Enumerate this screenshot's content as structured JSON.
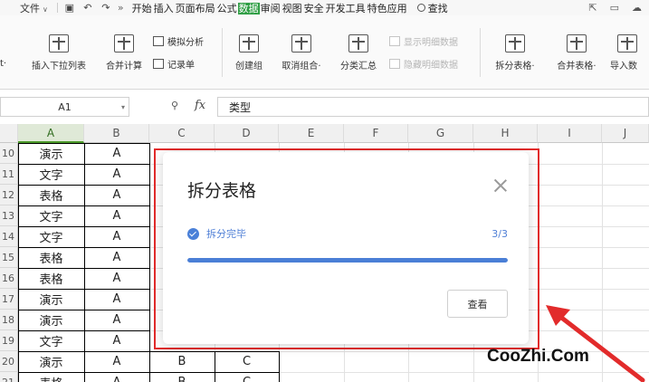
{
  "menu": {
    "file_label": "文件",
    "tabs": [
      "开始",
      "插入",
      "页面布局",
      "公式",
      "数据",
      "审阅",
      "视图",
      "安全",
      "开发工具",
      "特色应用"
    ],
    "active_tab_index": 4,
    "search_label": "查找"
  },
  "ribbon": {
    "buttons": [
      {
        "id": "insert-dropdown",
        "label": "插入下拉列表"
      },
      {
        "id": "merge-calc",
        "label": "合并计算"
      },
      {
        "id": "create-group",
        "label": "创建组"
      },
      {
        "id": "ungroup",
        "label": "取消组合·"
      },
      {
        "id": "subtotal",
        "label": "分类汇总"
      },
      {
        "id": "split-table",
        "label": "拆分表格·"
      },
      {
        "id": "merge-table",
        "label": "合并表格·"
      },
      {
        "id": "import-data",
        "label": "导入数"
      }
    ],
    "small_buttons": [
      {
        "id": "what-if",
        "label": "模拟分析"
      },
      {
        "id": "record-form",
        "label": "记录单"
      },
      {
        "id": "show-detail",
        "label": "显示明细数据"
      },
      {
        "id": "hide-detail",
        "label": "隐藏明细数据"
      }
    ],
    "left_edge_label": "t·"
  },
  "formula_bar": {
    "name_box": "A1",
    "fx_label": "fx",
    "content": "类型"
  },
  "grid": {
    "columns": [
      "A",
      "B",
      "C",
      "D",
      "E",
      "F",
      "G",
      "H",
      "I",
      "J"
    ],
    "selected_column": "A",
    "row_numbers": [
      "10",
      "11",
      "12",
      "13",
      "14",
      "15",
      "16",
      "17",
      "18",
      "19",
      "20",
      "21"
    ],
    "rows": [
      [
        "演示",
        "A",
        "",
        ""
      ],
      [
        "文字",
        "A",
        "",
        ""
      ],
      [
        "表格",
        "A",
        "",
        ""
      ],
      [
        "文字",
        "A",
        "",
        ""
      ],
      [
        "文字",
        "A",
        "",
        ""
      ],
      [
        "表格",
        "A",
        "",
        ""
      ],
      [
        "表格",
        "A",
        "",
        ""
      ],
      [
        "演示",
        "A",
        "",
        ""
      ],
      [
        "演示",
        "A",
        "",
        ""
      ],
      [
        "文字",
        "A",
        "",
        ""
      ],
      [
        "演示",
        "A",
        "B",
        "C"
      ],
      [
        "表格",
        "A",
        "B",
        "C"
      ]
    ]
  },
  "dialog": {
    "title": "拆分表格",
    "status_text": "拆分完毕",
    "progress_text": "3/3",
    "progress_fraction": 1.0,
    "view_button": "查看"
  },
  "watermark": "CooZhi.Com",
  "colors": {
    "active_tab": "#2f9e44",
    "highlight_border": "#e22b2b",
    "progress": "#4a7fd6",
    "arrow": "#e22b2b"
  }
}
